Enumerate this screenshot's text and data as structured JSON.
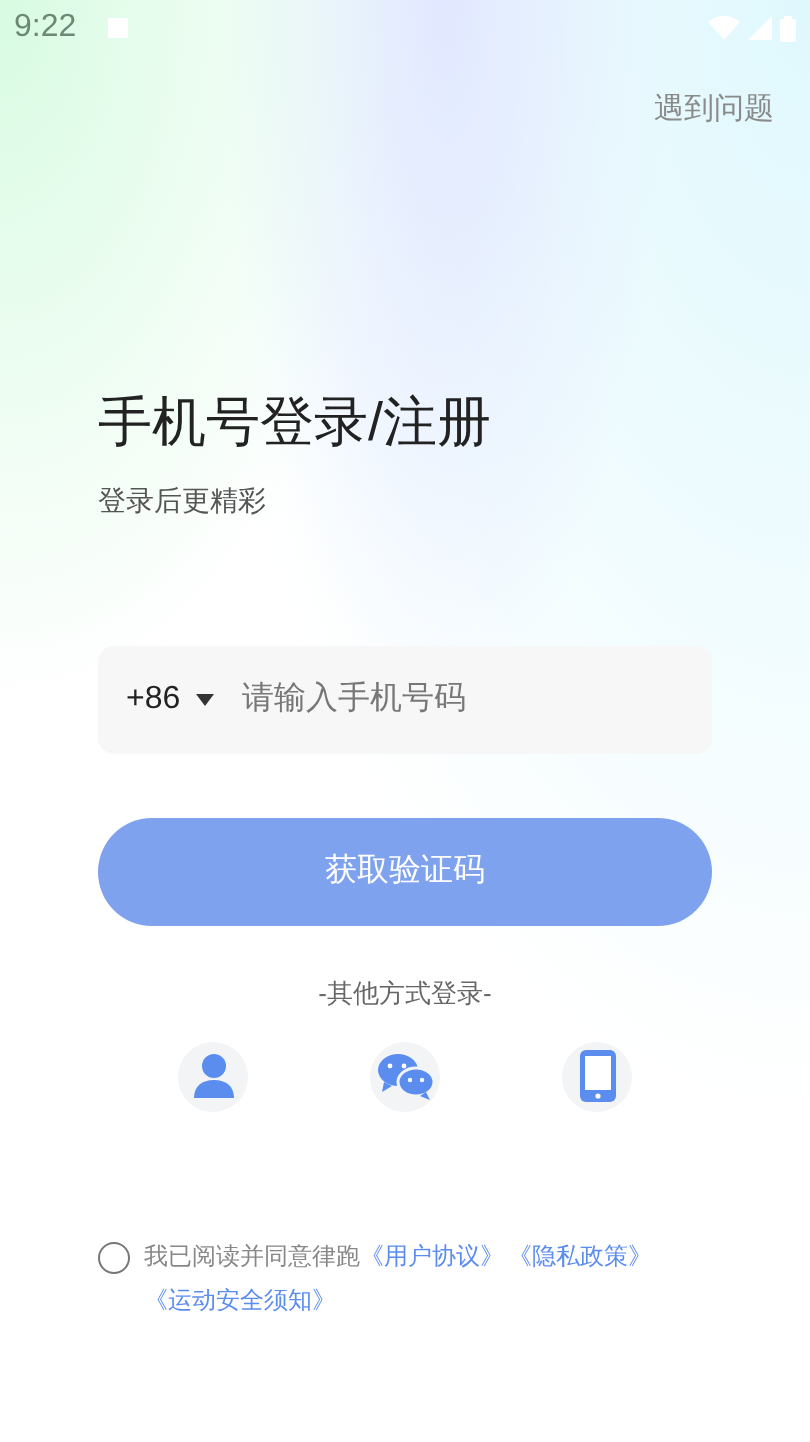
{
  "status_bar": {
    "time": "9:22"
  },
  "help_link": "遇到问题",
  "title": "手机号登录/注册",
  "subtitle": "登录后更精彩",
  "phone": {
    "country_code": "+86",
    "placeholder": "请输入手机号码"
  },
  "submit": {
    "label": "获取验证码",
    "disabled": true
  },
  "other_login": {
    "label": "-其他方式登录-",
    "options": [
      {
        "kind": "account"
      },
      {
        "kind": "wechat"
      },
      {
        "kind": "phone"
      }
    ]
  },
  "agreement": {
    "checked": false,
    "text": "我已阅读并同意律跑",
    "links": [
      "《用户协议》",
      "《隐私政策》",
      "《运动安全须知》"
    ]
  }
}
